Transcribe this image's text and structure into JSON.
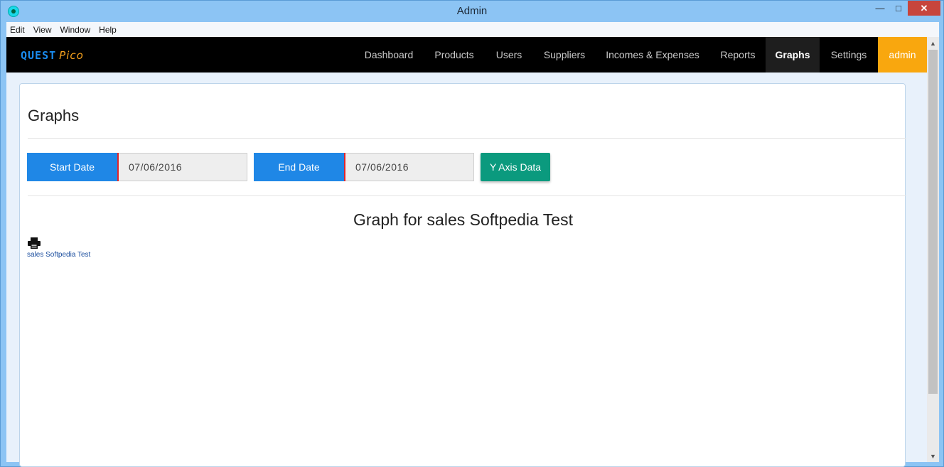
{
  "window": {
    "title": "Admin",
    "controls": {
      "minimize": "—",
      "maximize": "□",
      "close": "✕"
    }
  },
  "menu": [
    "Edit",
    "View",
    "Window",
    "Help"
  ],
  "brand": {
    "part1": "QUEST",
    "part2": "Pico",
    "color1": "#1a8cf0",
    "color2": "#f7a21d"
  },
  "nav": {
    "items": [
      "Dashboard",
      "Products",
      "Users",
      "Suppliers",
      "Incomes & Expenses",
      "Reports",
      "Graphs",
      "Settings"
    ],
    "active": "Graphs",
    "user": "admin",
    "user_color": "#f9a70e"
  },
  "page": {
    "title": "Graphs",
    "start_label": "Start Date",
    "start_value": "07/06/2016",
    "end_label": "End Date",
    "end_value": "07/06/2016",
    "y_axis_button": "Y Axis Data",
    "graph_title": "Graph for sales Softpedia Test",
    "print_icon": "printer-icon",
    "legend": "sales Softpedia Test"
  },
  "colors": {
    "primary": "#1f87e6",
    "accent": "#0b9a7e",
    "navbar": "#000000"
  }
}
